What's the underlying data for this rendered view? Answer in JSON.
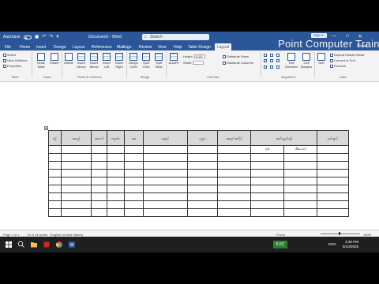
{
  "titlebar": {
    "autosave_label": "AutoSave",
    "doc_title": "Document1 - Word",
    "search_placeholder": "Search",
    "signin_label": "Sign in",
    "watermark": "Point Computer Training",
    "controls": [
      "—",
      "□",
      "✕"
    ]
  },
  "tabs": {
    "items": [
      "File",
      "Home",
      "Insert",
      "Design",
      "Layout",
      "References",
      "Mailings",
      "Review",
      "View",
      "Help",
      "Table Design",
      "Layout"
    ],
    "active_index": 11,
    "share_label": "Share"
  },
  "ribbon": {
    "table_group": {
      "label": "Table",
      "items": [
        "Select",
        "View Gridlines",
        "Properties"
      ]
    },
    "draw_group": {
      "label": "Draw",
      "items": [
        "Draw Table",
        "Eraser"
      ]
    },
    "rows_columns_group": {
      "label": "Rows & Columns",
      "items": [
        "Delete",
        "Insert Above",
        "Insert Below",
        "Insert Left",
        "Insert Right"
      ]
    },
    "merge_group": {
      "label": "Merge",
      "items": [
        "Merge Cells",
        "Split Cells",
        "Split Table"
      ]
    },
    "cell_size_group": {
      "label": "Cell Size",
      "autofit": "AutoFit",
      "height_label": "Height:",
      "height_value": "0.19\"",
      "width_label": "Width:",
      "width_value": "",
      "distribute_rows": "Distribute Rows",
      "distribute_columns": "Distribute Columns"
    },
    "alignment_group": {
      "label": "Alignment",
      "items": [
        "Text Direction",
        "Cell Margins"
      ]
    },
    "data_group": {
      "label": "Data",
      "sort": "Sort",
      "repeat_header": "Repeat Header Rows",
      "convert": "Convert to Text",
      "formula": "Formula"
    }
  },
  "document": {
    "table": {
      "headers": [
        "စဉ်",
        "အမည်",
        "အသက်",
        "ကျား/မ",
        "အဖ",
        "နေရပ်",
        "ပညာ",
        "အလုပ်အကိုင်",
        "ဆက်သွယ်ရန်",
        "မှတ်ချက်"
      ],
      "first_row": [
        "",
        "",
        "",
        "",
        "",
        "",
        "",
        "",
        "ဖုန်း",
        "အီးမေးလ်",
        ""
      ],
      "row_count": 9
    }
  },
  "statusbar": {
    "page": "Page 1 of 1",
    "words": "14 of 14 words",
    "language": "English (United States)",
    "focus": "Focus",
    "zoom": "100%"
  },
  "taskbar": {
    "temperature": "6.5C",
    "language": "ENG",
    "time": "4:40 PM",
    "date": "5/10/2025"
  }
}
